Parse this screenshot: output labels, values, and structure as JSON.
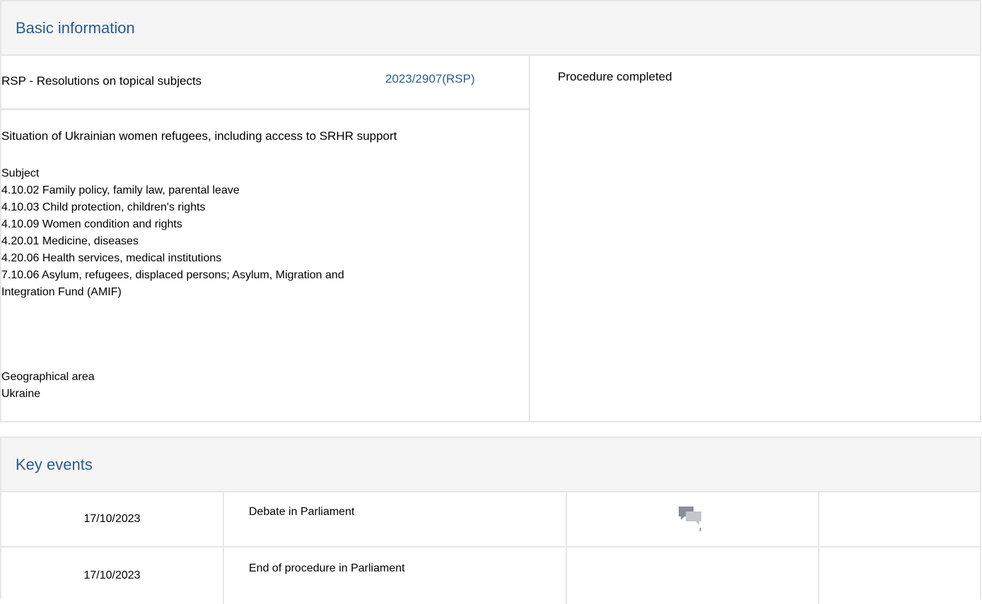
{
  "basic": {
    "title": "Basic information",
    "procedure_type": "RSP - Resolutions on topical subjects",
    "reference": "2023/2907(RSP)",
    "status": "Procedure completed",
    "procedure_title": "Situation of Ukrainian women refugees, including access to SRHR support",
    "subject_heading": "Subject",
    "subjects": [
      "4.10.02 Family policy, family law, parental leave",
      "4.10.03 Child protection, children's rights",
      "4.10.09 Women condition and rights",
      "4.20.01 Medicine, diseases",
      "4.20.06 Health services, medical institutions",
      "7.10.06 Asylum, refugees, displaced persons; Asylum, Migration and",
      "Integration Fund (AMIF)"
    ],
    "geo_heading": "Geographical area",
    "geo_value": "Ukraine"
  },
  "events": {
    "title": "Key events",
    "rows": [
      {
        "date": "17/10/2023",
        "event": "Debate in Parliament",
        "icon": "debate-icon"
      },
      {
        "date": "17/10/2023",
        "event": "End of procedure in Parliament"
      }
    ]
  },
  "colors": {
    "accent": "#2a5d8d",
    "border": "#e6e6e6",
    "header_bg": "#f5f5f5"
  }
}
